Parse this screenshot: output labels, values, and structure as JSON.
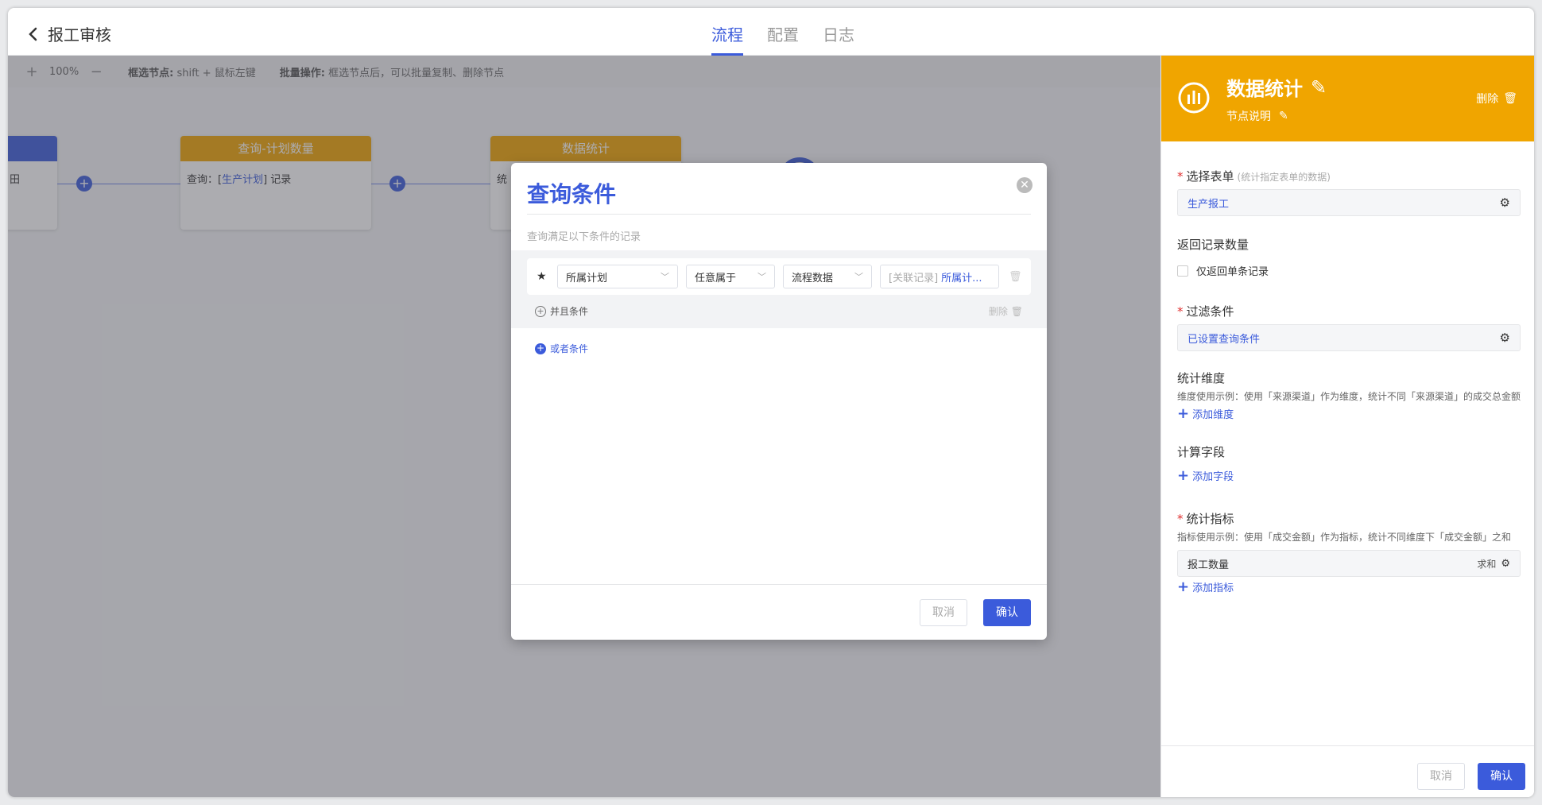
{
  "header": {
    "title": "报工审核",
    "tabs": [
      {
        "label": "流程",
        "active": true
      },
      {
        "label": "配置",
        "active": false
      },
      {
        "label": "日志",
        "active": false
      }
    ]
  },
  "toolbar": {
    "zoom": "100%",
    "hint1_label": "框选节点:",
    "hint1_text": "shift + 鼠标左键",
    "hint2_label": "批量操作:",
    "hint2_text": "框选节点后，可以批量复制、删除节点"
  },
  "nodes": [
    {
      "title": "",
      "body": "田"
    },
    {
      "title": "查询-计划数量",
      "body_prefix": "查询：[",
      "body_link": "生产计划",
      "body_suffix": "] 记录"
    },
    {
      "title": "数据统计",
      "body": "统"
    }
  ],
  "colors": {
    "accent": "#3b5bdb",
    "node_orange": "#f0a500"
  },
  "modal": {
    "title": "查询条件",
    "subtitle": "查询满足以下条件的记录",
    "condition": {
      "field": "所属计划",
      "operator": "任意属于",
      "source": "流程数据",
      "value_placeholder": "[关联记录]",
      "value_link": "所属计..."
    },
    "and_label": "并且条件",
    "delete_label": "删除",
    "or_label": "或者条件",
    "cancel": "取消",
    "ok": "确认"
  },
  "panel": {
    "title": "数据统计",
    "subtitle": "节点说明",
    "delete": "删除",
    "select_form_label": "选择表单",
    "select_form_note": "(统计指定表单的数据)",
    "select_form_value": "生产报工",
    "return_count_label": "返回记录数量",
    "return_single_label": "仅返回单条记录",
    "filter_label": "过滤条件",
    "filter_value": "已设置查询条件",
    "dimension_label": "统计维度",
    "dimension_note": "维度使用示例：使用「来源渠道」作为维度，统计不同「来源渠道」的成交总金额",
    "add_dimension": "添加维度",
    "calc_field_label": "计算字段",
    "add_field": "添加字段",
    "metric_label": "统计指标",
    "metric_note": "指标使用示例：使用「成交金额」作为指标，统计不同维度下「成交金额」之和",
    "metric_value": "报工数量",
    "metric_agg": "求和",
    "add_metric": "添加指标",
    "cancel": "取消",
    "ok": "确认"
  }
}
